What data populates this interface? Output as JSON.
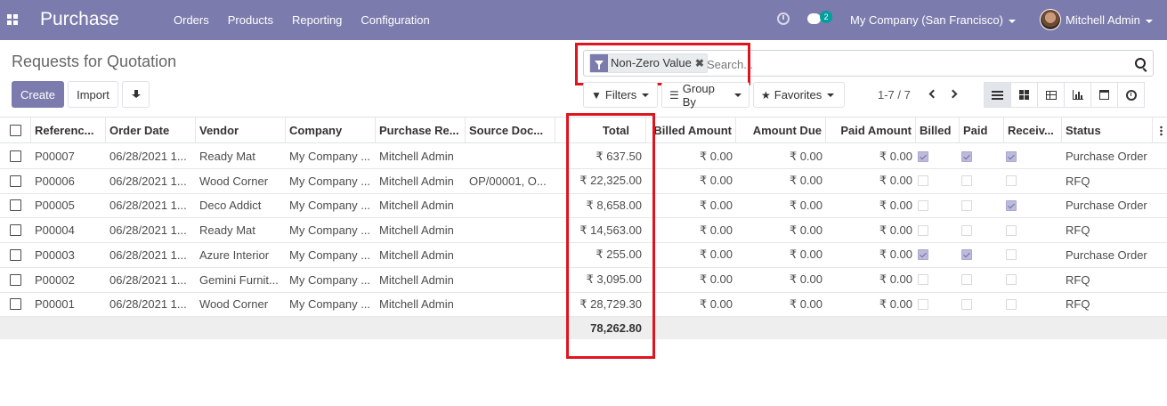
{
  "app": {
    "title": "Purchase",
    "menu": [
      "Orders",
      "Products",
      "Reporting",
      "Configuration"
    ],
    "notifications_count": "2",
    "company": "My Company (San Francisco)",
    "user": "Mitchell Admin"
  },
  "page": {
    "title": "Requests for Quotation",
    "create_label": "Create",
    "import_label": "Import"
  },
  "search": {
    "facet_label": "Non-Zero Value",
    "facet_remove": "✖",
    "placeholder": "Search..."
  },
  "toolbar": {
    "filters_label": "Filters",
    "groupby_label": "Group By",
    "favorites_label": "Favorites",
    "pager": "1-7 / 7"
  },
  "colors": {
    "navbar": "#7c7bad",
    "highlight": "#e0141e",
    "checkbox_checked": "#bdbbdc"
  },
  "table": {
    "columns": [
      "Referenc...",
      "Order Date",
      "Vendor",
      "Company",
      "Purchase Re...",
      "Source Doc...",
      "Total",
      "Billed Amount",
      "Amount Due",
      "Paid Amount",
      "Billed",
      "Paid",
      "Receiv...",
      "Status"
    ],
    "rows": [
      {
        "ref": "P00007",
        "date": "06/28/2021 1...",
        "vendor": "Ready Mat",
        "company": "My Company ...",
        "rep": "Mitchell Admin",
        "source": "",
        "total": "₹ 637.50",
        "billed_amount": "₹ 0.00",
        "amount_due": "₹ 0.00",
        "paid_amount": "₹ 0.00",
        "billed": true,
        "paid": true,
        "received": true,
        "status": "Purchase Order"
      },
      {
        "ref": "P00006",
        "date": "06/28/2021 1...",
        "vendor": "Wood Corner",
        "company": "My Company ...",
        "rep": "Mitchell Admin",
        "source": "OP/00001, O...",
        "total": "₹ 22,325.00",
        "billed_amount": "₹ 0.00",
        "amount_due": "₹ 0.00",
        "paid_amount": "₹ 0.00",
        "billed": false,
        "paid": false,
        "received": false,
        "status": "RFQ"
      },
      {
        "ref": "P00005",
        "date": "06/28/2021 1...",
        "vendor": "Deco Addict",
        "company": "My Company ...",
        "rep": "Mitchell Admin",
        "source": "",
        "total": "₹ 8,658.00",
        "billed_amount": "₹ 0.00",
        "amount_due": "₹ 0.00",
        "paid_amount": "₹ 0.00",
        "billed": false,
        "paid": false,
        "received": true,
        "status": "Purchase Order"
      },
      {
        "ref": "P00004",
        "date": "06/28/2021 1...",
        "vendor": "Ready Mat",
        "company": "My Company ...",
        "rep": "Mitchell Admin",
        "source": "",
        "total": "₹ 14,563.00",
        "billed_amount": "₹ 0.00",
        "amount_due": "₹ 0.00",
        "paid_amount": "₹ 0.00",
        "billed": false,
        "paid": false,
        "received": false,
        "status": "RFQ"
      },
      {
        "ref": "P00003",
        "date": "06/28/2021 1...",
        "vendor": "Azure Interior",
        "company": "My Company ...",
        "rep": "Mitchell Admin",
        "source": "",
        "total": "₹ 255.00",
        "billed_amount": "₹ 0.00",
        "amount_due": "₹ 0.00",
        "paid_amount": "₹ 0.00",
        "billed": true,
        "paid": true,
        "received": false,
        "status": "Purchase Order"
      },
      {
        "ref": "P00002",
        "date": "06/28/2021 1...",
        "vendor": "Gemini Furnit...",
        "company": "My Company ...",
        "rep": "Mitchell Admin",
        "source": "",
        "total": "₹ 3,095.00",
        "billed_amount": "₹ 0.00",
        "amount_due": "₹ 0.00",
        "paid_amount": "₹ 0.00",
        "billed": false,
        "paid": false,
        "received": false,
        "status": "RFQ"
      },
      {
        "ref": "P00001",
        "date": "06/28/2021 1...",
        "vendor": "Wood Corner",
        "company": "My Company ...",
        "rep": "Mitchell Admin",
        "source": "",
        "total": "₹ 28,729.30",
        "billed_amount": "₹ 0.00",
        "amount_due": "₹ 0.00",
        "paid_amount": "₹ 0.00",
        "billed": false,
        "paid": false,
        "received": false,
        "status": "RFQ"
      }
    ],
    "footer_total": "78,262.80"
  }
}
